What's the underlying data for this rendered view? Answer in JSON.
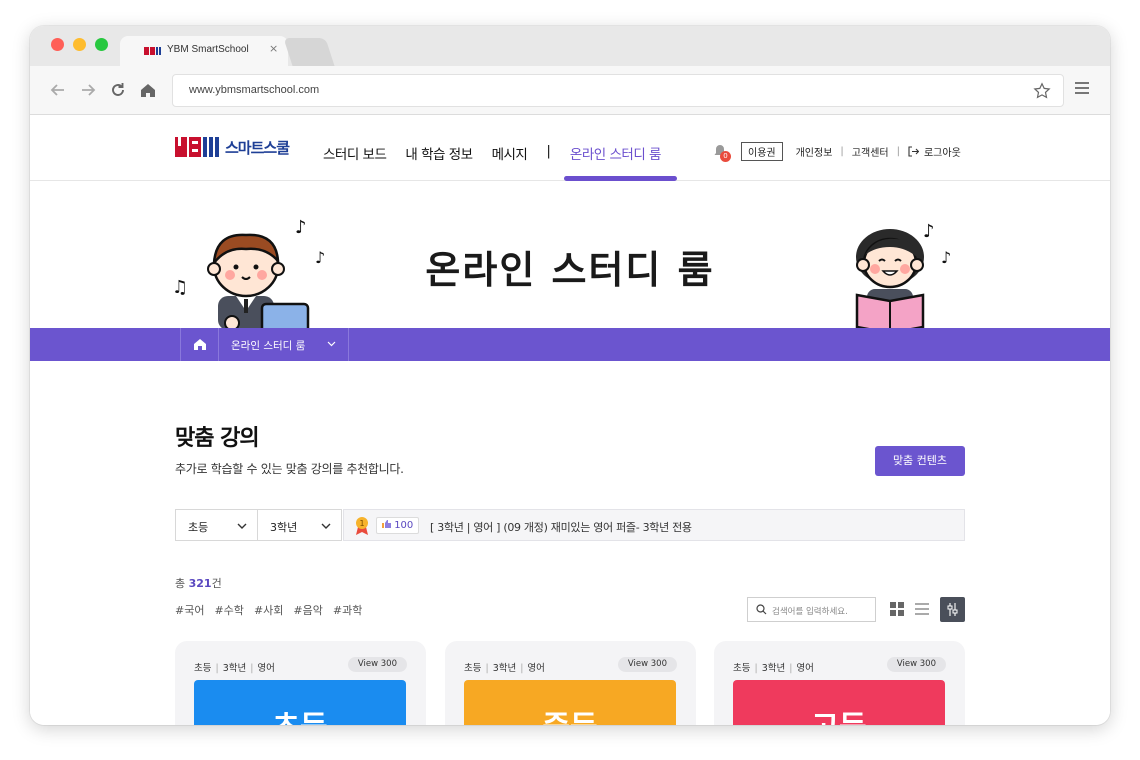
{
  "browser": {
    "tab_title": "YBM SmartSchool",
    "tab_close": "×",
    "url": "www.ybmsmartschool.com"
  },
  "header": {
    "logo_mark": "YBM",
    "logo_text": "스마트스쿨",
    "nav": [
      "스터디 보드",
      "내 학습 정보",
      "메시지",
      "|",
      "온라인 스터디 룸"
    ],
    "notification_count": "0",
    "pass_label": "이용권",
    "links": [
      "개인정보",
      "고객센터"
    ],
    "logout": "로그아웃"
  },
  "hero": {
    "title": "온라인 스터디 룸"
  },
  "subnav": {
    "current": "온라인 스터디 룸"
  },
  "main": {
    "title": "맞춤 강의",
    "description": "추가로 학습할 수 있는 맞춤 강의를 추천합니다.",
    "cta_label": "맞춤 컨텐츠",
    "filter_level": "초등",
    "filter_grade": "3학년",
    "rec": {
      "rank": "1",
      "likes": "100",
      "text": "[ 3학년 | 영어 ] (09 개정) 재미있는 영어 퍼즐- 3학년 전용"
    },
    "count_prefix": "총 ",
    "count_value": "321",
    "count_suffix": "건",
    "tags": [
      "#국어",
      "#수학",
      "#사회",
      "#음악",
      "#과학"
    ],
    "search_placeholder": "검색어를 입력하세요."
  },
  "cards": [
    {
      "level": "초등",
      "grade": "3학년",
      "subject": "영어",
      "views": "View 300",
      "thumb_label": "초등",
      "color": "#1a8cf0"
    },
    {
      "level": "초등",
      "grade": "3학년",
      "subject": "영어",
      "views": "View 300",
      "thumb_label": "중등",
      "color": "#f7a823"
    },
    {
      "level": "초등",
      "grade": "3학년",
      "subject": "영어",
      "views": "View 300",
      "thumb_label": "고등",
      "color": "#ef3a5d"
    }
  ],
  "colors": {
    "accent": "#6b55cf",
    "brand_red": "#c8102e",
    "brand_blue": "#1e3f96"
  }
}
